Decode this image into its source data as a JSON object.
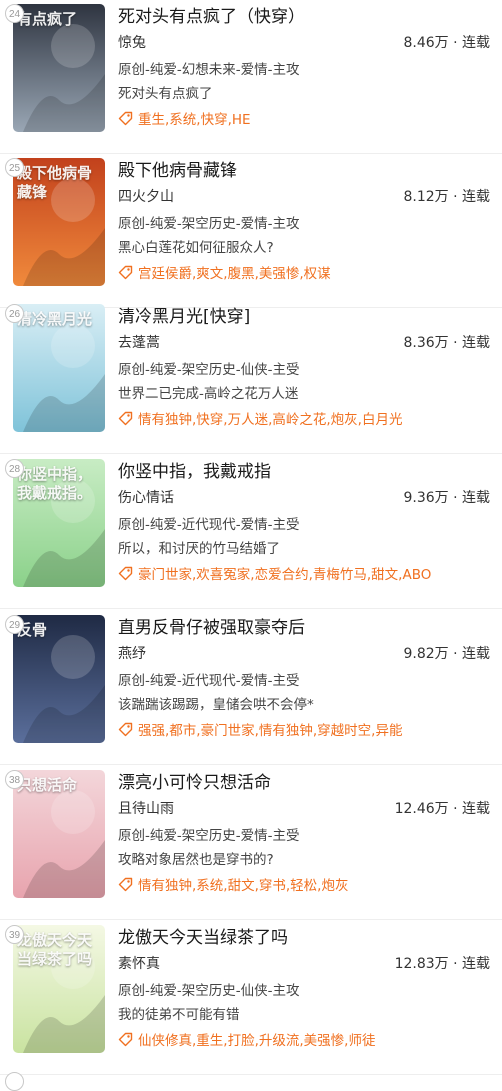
{
  "books": [
    {
      "rank": "24",
      "title": "死对头有点疯了（快穿）",
      "author": "惊兔",
      "stats": "8.46万 · 连载",
      "category": "原创-纯爱-幻想未来-爱情-主攻",
      "summary": "死对头有点疯了",
      "tags": "重生,系统,快穿,HE",
      "cover_text": "有点疯了",
      "cover_colors": [
        "#2e3440",
        "#9aa7b5"
      ]
    },
    {
      "rank": "25",
      "title": "殿下他病骨藏锋",
      "author": "四火夕山",
      "stats": "8.12万 · 连载",
      "category": "原创-纯爱-架空历史-爱情-主攻",
      "summary": "黑心白莲花如何征服众人?",
      "tags": "宫廷侯爵,爽文,腹黑,美强惨,权谋",
      "cover_text": "殿下他病骨藏锋",
      "cover_colors": [
        "#c2411c",
        "#f08a3c"
      ]
    },
    {
      "rank": "26",
      "title": "清冷黑月光[快穿]",
      "author": "去蓬蒿",
      "stats": "8.36万 · 连载",
      "category": "原创-纯爱-架空历史-仙侠-主受",
      "summary": "世界二已完成-高岭之花万人迷",
      "tags": "情有独钟,快穿,万人迷,高岭之花,炮灰,白月光",
      "cover_text": "清冷黑月光",
      "cover_colors": [
        "#d9eef5",
        "#7fc3d9"
      ]
    },
    {
      "rank": "28",
      "title": "你竖中指，我戴戒指",
      "author": "伤心情话",
      "stats": "9.36万 · 连载",
      "category": "原创-纯爱-近代现代-爱情-主受",
      "summary": "所以，和讨厌的竹马结婚了",
      "tags": "豪门世家,欢喜冤家,恋爱合约,青梅竹马,甜文,ABO",
      "cover_text": "你竖中指，我戴戒指。",
      "cover_colors": [
        "#c8ecc4",
        "#8bd18a"
      ]
    },
    {
      "rank": "29",
      "title": "直男反骨仔被强取豪夺后",
      "author": "燕纾",
      "stats": "9.82万 · 连载",
      "category": "原创-纯爱-近代现代-爱情-主受",
      "summary": "该踹踹该踢踢，皇储会哄不会停*",
      "tags": "强强,都市,豪门世家,情有独钟,穿越时空,异能",
      "cover_text": "反骨",
      "cover_colors": [
        "#1f2a44",
        "#5b6f9c"
      ]
    },
    {
      "rank": "38",
      "title": "漂亮小可怜只想活命",
      "author": "且待山雨",
      "stats": "12.46万 · 连载",
      "category": "原创-纯爱-架空历史-爱情-主受",
      "summary": "攻略对象居然也是穿书的?",
      "tags": "情有独钟,系统,甜文,穿书,轻松,炮灰",
      "cover_text": "只想活命",
      "cover_colors": [
        "#f3d6da",
        "#e8a4ae"
      ]
    },
    {
      "rank": "39",
      "title": "龙傲天今天当绿茶了吗",
      "author": "素怀真",
      "stats": "12.83万 · 连载",
      "category": "原创-纯爱-架空历史-仙侠-主攻",
      "summary": "我的徒弟不可能有错",
      "tags": "仙侠修真,重生,打脸,升级流,美强惨,师徒",
      "cover_text": "龙傲天今天当绿茶了吗",
      "cover_colors": [
        "#f4f8e4",
        "#c9e3a0"
      ]
    }
  ],
  "colors": {
    "tag": "#f07020",
    "badge_border": "#c8c8c8"
  },
  "tag_icon_name": "tag-icon"
}
